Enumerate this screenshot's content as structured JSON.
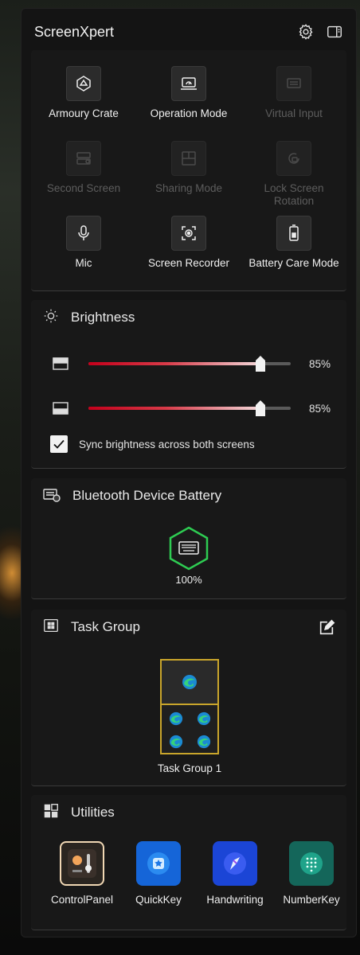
{
  "header": {
    "title": "ScreenXpert"
  },
  "quick_actions": [
    {
      "label": "Armoury Crate",
      "enabled": true,
      "icon": "armoury-crate-icon"
    },
    {
      "label": "Operation Mode",
      "enabled": true,
      "icon": "operation-mode-icon"
    },
    {
      "label": "Virtual Input",
      "enabled": false,
      "icon": "virtual-input-icon"
    },
    {
      "label": "Second Screen",
      "enabled": false,
      "icon": "second-screen-icon"
    },
    {
      "label": "Sharing Mode",
      "enabled": false,
      "icon": "sharing-mode-icon"
    },
    {
      "label": "Lock Screen Rotation",
      "enabled": false,
      "icon": "lock-rotation-icon"
    },
    {
      "label": "Mic",
      "enabled": true,
      "icon": "mic-icon"
    },
    {
      "label": "Screen Recorder",
      "enabled": true,
      "icon": "screen-recorder-icon"
    },
    {
      "label": "Battery Care Mode",
      "enabled": true,
      "icon": "battery-care-icon"
    }
  ],
  "brightness": {
    "title": "Brightness",
    "screens": [
      {
        "name": "top-screen",
        "value_label": "85%",
        "value": 85
      },
      {
        "name": "bottom-screen",
        "value_label": "85%",
        "value": 85
      }
    ],
    "sync_label": "Sync brightness across both screens",
    "sync_checked": true
  },
  "bluetooth": {
    "title": "Bluetooth Device Battery",
    "devices": [
      {
        "icon": "keyboard-icon",
        "battery_label": "100%",
        "battery": 100
      }
    ]
  },
  "task_group": {
    "title": "Task Group",
    "groups": [
      {
        "label": "Task Group 1",
        "apps": [
          "edge",
          "edge",
          "edge",
          "edge",
          "edge"
        ]
      }
    ]
  },
  "utilities": {
    "title": "Utilities",
    "items": [
      {
        "label": "ControlPanel",
        "icon": "control-panel-icon"
      },
      {
        "label": "QuickKey",
        "icon": "quickkey-icon"
      },
      {
        "label": "Handwriting",
        "icon": "handwriting-icon"
      },
      {
        "label": "NumberKey",
        "icon": "numberkey-icon"
      }
    ]
  },
  "colors": {
    "accent_red": "#c4001b",
    "task_group_border": "#c9a52b",
    "battery_green": "#2ecc52"
  }
}
